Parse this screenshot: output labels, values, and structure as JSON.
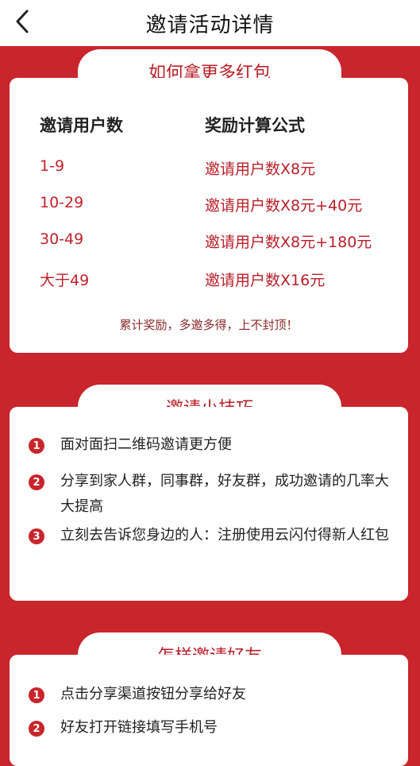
{
  "header": {
    "title": "邀请活动详情",
    "back_icon": "chevron-left-icon"
  },
  "reward": {
    "tab_title": "如何拿更多红包",
    "col_users": "邀请用户数",
    "col_formula": "奖励计算公式",
    "rows": [
      {
        "range": "1-9",
        "formula": "邀请用户数X8元"
      },
      {
        "range": "10-29",
        "formula": "邀请用户数X8元+40元"
      },
      {
        "range": "30-49",
        "formula": "邀请用户数X8元+180元"
      },
      {
        "range": "大于49",
        "formula": "邀请用户数X16元"
      }
    ],
    "note": "累计奖励，多邀多得，上不封顶！"
  },
  "tips": {
    "tab_title": "邀请小技巧",
    "items": [
      {
        "num": "1",
        "text": "面对面扫二维码邀请更方便"
      },
      {
        "num": "2",
        "text": "分享到家人群，同事群，好友群，成功邀请的几率大大提高"
      },
      {
        "num": "3",
        "text": "立刻去告诉您身边的人：注册使用云闪付得新人红包"
      }
    ]
  },
  "howto": {
    "tab_title": "怎样邀请好友",
    "items": [
      {
        "num": "1",
        "text": "点击分享渠道按钮分享给好友"
      },
      {
        "num": "2",
        "text": "好友打开链接填写手机号"
      }
    ]
  },
  "colors": {
    "accent": "#c9252c",
    "text_red": "#b8202a"
  }
}
